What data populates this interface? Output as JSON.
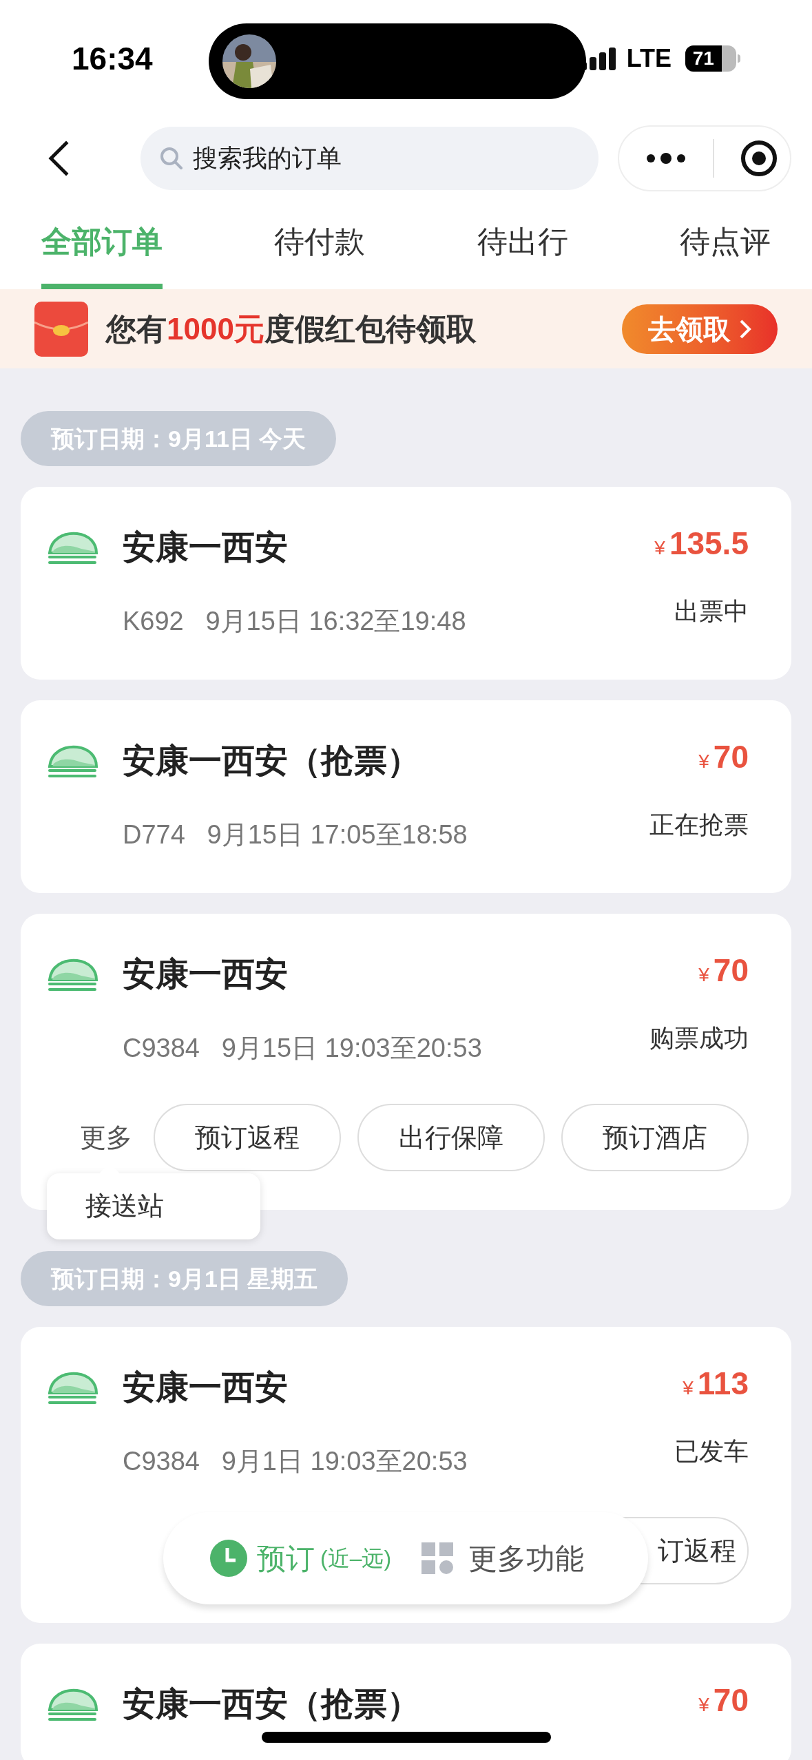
{
  "status_bar": {
    "time": "16:34",
    "network": "LTE",
    "battery": "71"
  },
  "search": {
    "placeholder": "搜索我的订单"
  },
  "tabs": [
    {
      "label": "全部订单",
      "selected": true
    },
    {
      "label": "待付款",
      "selected": false
    },
    {
      "label": "待出行",
      "selected": false
    },
    {
      "label": "待点评",
      "selected": false
    }
  ],
  "banner": {
    "prefix": "您有",
    "amount": "1000元",
    "suffix": "度假红包待领取",
    "button": "去领取"
  },
  "groups": [
    {
      "date_label": "预订日期：9月11日 今天",
      "orders": [
        {
          "route": "安康一西安",
          "currency": "¥",
          "price": "135.5",
          "train": "K692",
          "time": "9月15日 16:32至19:48",
          "status": "出票中"
        },
        {
          "route": "安康一西安（抢票）",
          "currency": "¥",
          "price": "70",
          "train": "D774",
          "time": "9月15日 17:05至18:58",
          "status": "正在抢票"
        },
        {
          "route": "安康一西安",
          "currency": "¥",
          "price": "70",
          "train": "C9384",
          "time": "9月15日 19:03至20:53",
          "status": "购票成功",
          "more": "更多",
          "popover": "接送站",
          "actions": [
            "预订返程",
            "出行保障",
            "预订酒店"
          ]
        }
      ]
    },
    {
      "date_label": "预订日期：9月1日 星期五",
      "orders": [
        {
          "route": "安康一西安",
          "currency": "¥",
          "price": "113",
          "train": "C9384",
          "time": "9月1日 19:03至20:53",
          "status": "已发车",
          "actions": [
            "订返程"
          ]
        },
        {
          "route": "安康一西安（抢票）",
          "currency": "¥",
          "price": "70"
        }
      ]
    }
  ],
  "floating_bar": {
    "book": "预订",
    "book_hint": "(近–远)",
    "more": "更多功能"
  }
}
